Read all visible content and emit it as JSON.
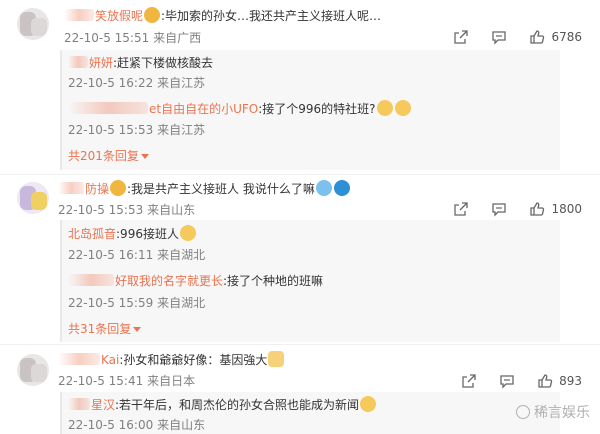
{
  "comments": [
    {
      "username": "笑放假呢",
      "text": ":毕加索的孙女…我还共产主义接班人呢…",
      "time": "22-10-5 15:51",
      "location": "来自广西",
      "likes": "6786",
      "replies": [
        {
          "username": "妍妍",
          "text": ":赶紧下楼做核酸去",
          "time": "22-10-5 16:22",
          "location": "来自江苏"
        },
        {
          "username": "et自由自在的小UFO",
          "text": ":接了个996的特社班?",
          "time": "22-10-5 15:53",
          "location": "来自江苏"
        }
      ],
      "more_replies": "共201条回复"
    },
    {
      "username": "防操",
      "text": ":我是共产主义接班人 我说什么了嘛",
      "time": "22-10-5 15:53",
      "location": "来自山东",
      "likes": "1800",
      "replies": [
        {
          "username": "北岛孤音",
          "text": ":996接班人",
          "time": "22-10-5 16:11",
          "location": "来自湖北"
        },
        {
          "username": "好取我的名字就更长",
          "text": ":接了个种地的班嘛",
          "time": "22-10-5 15:59",
          "location": "来自湖北"
        }
      ],
      "more_replies": "共31条回复"
    },
    {
      "username": "Kai",
      "text": ":孙女和爺爺好像：基因強大",
      "time": "22-10-5 15:41",
      "location": "来自日本",
      "likes": "893",
      "replies": [
        {
          "username": "星汉",
          "text": ":若干年后，和周杰伦的孙女合照也能成为新闻",
          "time": "22-10-5 16:00",
          "location": "来自山东"
        }
      ]
    }
  ],
  "watermark": "稀言娱乐",
  "icons": {
    "share": "share-icon",
    "comment": "comment-icon",
    "like": "thumbs-up-icon"
  }
}
